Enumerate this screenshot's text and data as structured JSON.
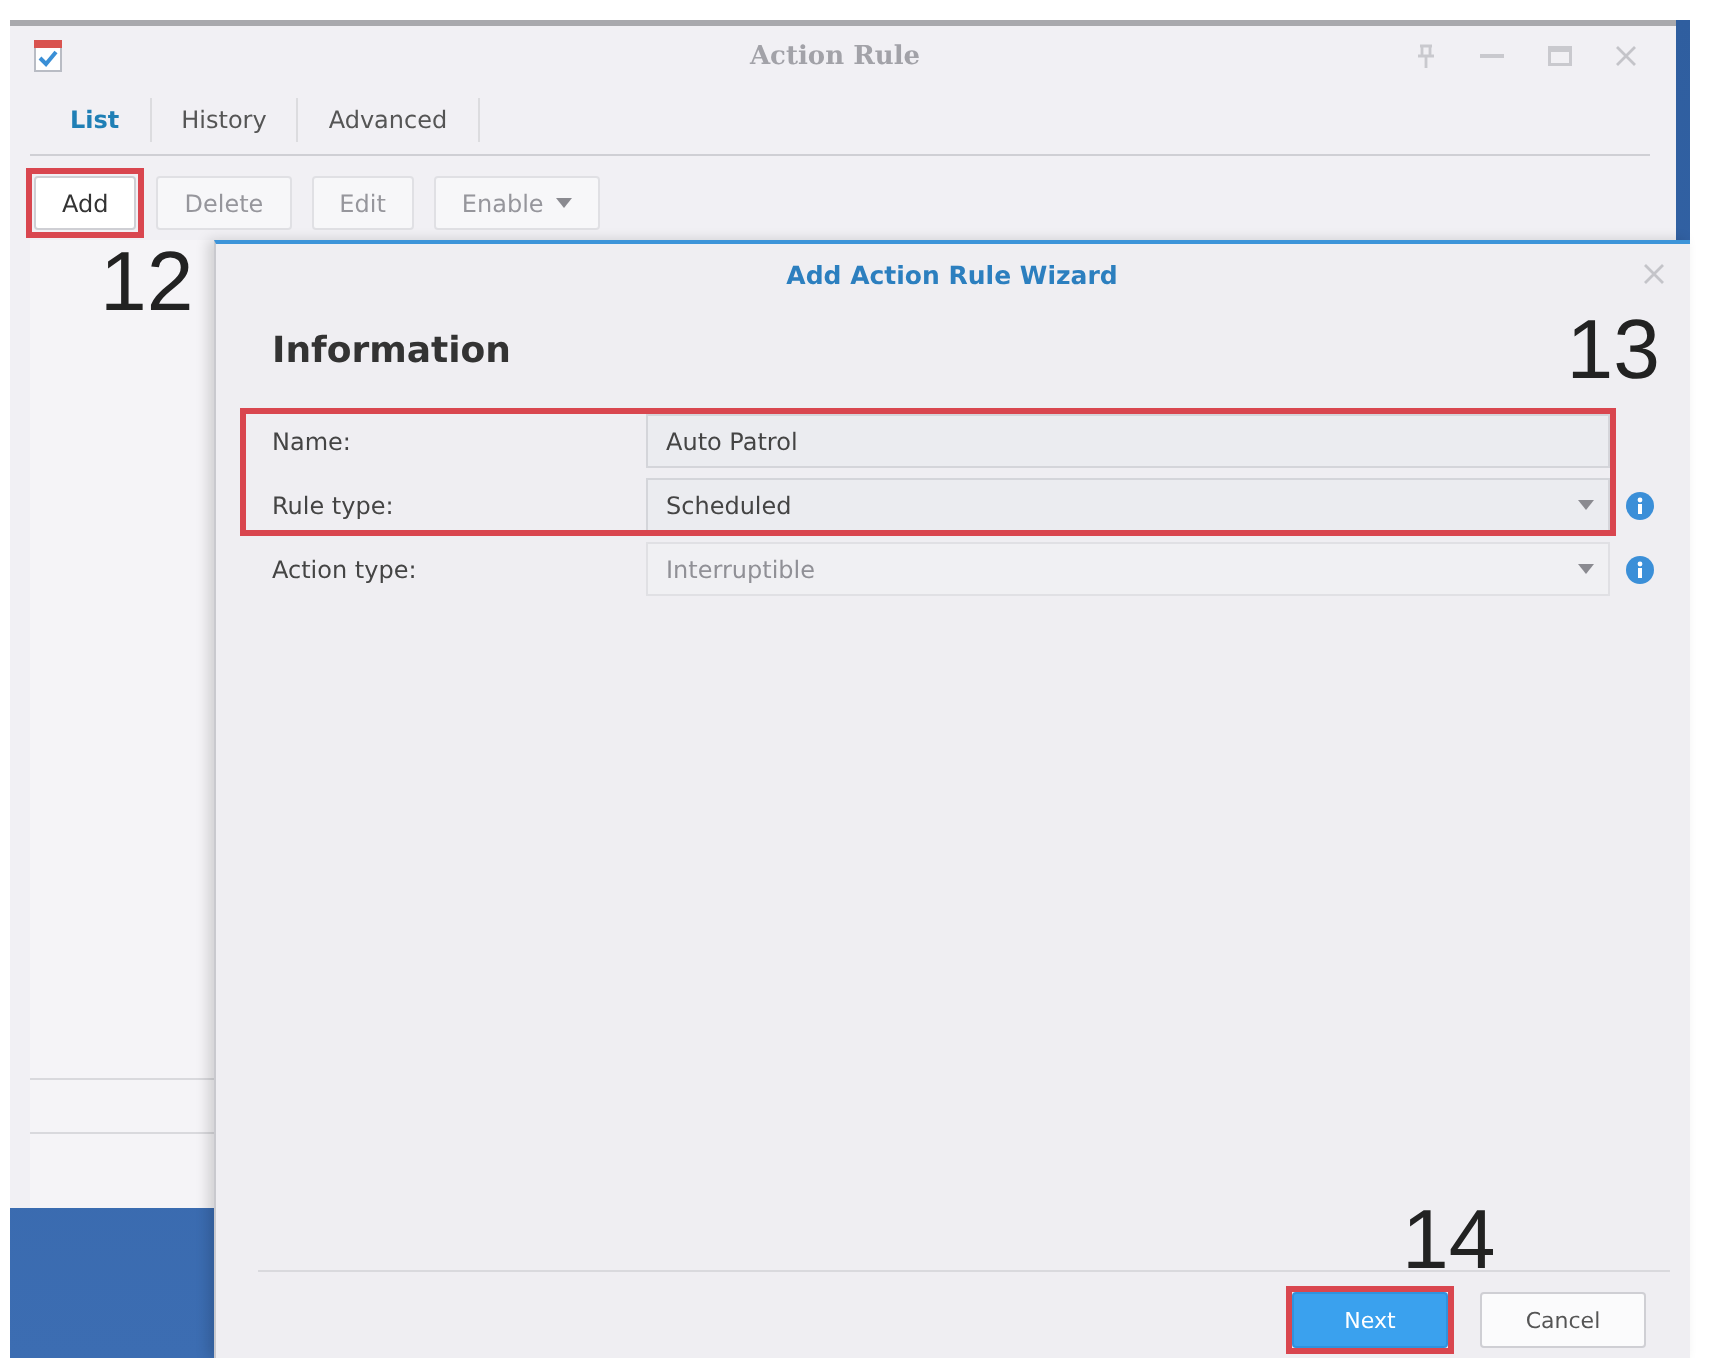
{
  "window": {
    "title": "Action Rule",
    "tabs": [
      {
        "label": "List",
        "selected": true
      },
      {
        "label": "History",
        "selected": false
      },
      {
        "label": "Advanced",
        "selected": false
      }
    ],
    "toolbar": {
      "callout": "12",
      "buttons": [
        {
          "label": "Add",
          "disabled": false,
          "highlighted": true,
          "dropdown": false
        },
        {
          "label": "Delete",
          "disabled": true,
          "highlighted": false,
          "dropdown": false
        },
        {
          "label": "Edit",
          "disabled": true,
          "highlighted": false,
          "dropdown": false
        },
        {
          "label": "Enable",
          "disabled": true,
          "highlighted": false,
          "dropdown": true
        }
      ]
    }
  },
  "wizard": {
    "title": "Add Action Rule Wizard",
    "section": "Information",
    "callout": "13",
    "fields": [
      {
        "label": "Name:",
        "kind": "text",
        "value": "Auto Patrol",
        "disabled": false,
        "highlighted": true,
        "info": false
      },
      {
        "label": "Rule type:",
        "kind": "dropdown",
        "value": "Scheduled",
        "disabled": false,
        "highlighted": true,
        "info": true
      },
      {
        "label": "Action type:",
        "kind": "dropdown",
        "value": "Interruptible",
        "disabled": true,
        "highlighted": false,
        "info": true
      }
    ],
    "footer": {
      "callout": "14",
      "buttons": [
        {
          "label": "Next",
          "kind": "primary",
          "highlighted": true
        },
        {
          "label": "Cancel",
          "kind": "secondary",
          "highlighted": false
        }
      ]
    }
  }
}
